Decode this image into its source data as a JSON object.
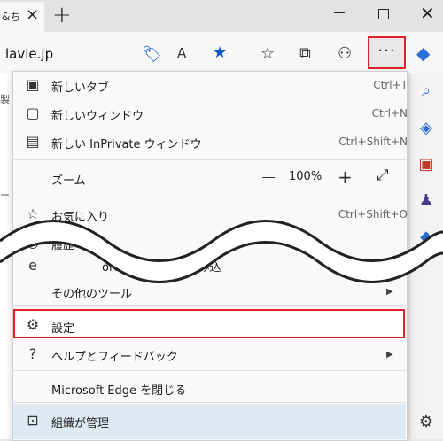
{
  "tab": {
    "title": "&ち",
    "close": "×"
  },
  "new_tab": "+",
  "window": {
    "close": "✕"
  },
  "address": {
    "text": "lavie.jp"
  },
  "toolbar": {
    "more": "···"
  },
  "menu": {
    "new_tab": {
      "label": "新しいタブ",
      "shortcut": "Ctrl+T"
    },
    "new_window": {
      "label": "新しいウィンドウ",
      "shortcut": "Ctrl+N"
    },
    "new_inprivate": {
      "label": "新しい InPrivate ウィンドウ",
      "shortcut": "Ctrl+Shift+N"
    },
    "zoom": {
      "label": "ズーム",
      "value": "100%"
    },
    "favorites": {
      "label": "お気に入り",
      "shortcut": "Ctrl+Shift+O"
    },
    "history": {
      "label": "履歴"
    },
    "ie_mode": {
      "label": "orer モードで再読み込"
    },
    "more_tools": {
      "label": "その他のツール"
    },
    "settings": {
      "label": "設定"
    },
    "help": {
      "label": "ヘルプとフィードバック"
    },
    "close_edge": {
      "label": "Microsoft Edge を閉じる"
    },
    "managed": {
      "label": "組織が管理"
    }
  },
  "page_snippets": [
    "製",
    "ー"
  ],
  "colors": {
    "highlight": "#e0202a",
    "accent_blue": "#0a5bd3"
  }
}
